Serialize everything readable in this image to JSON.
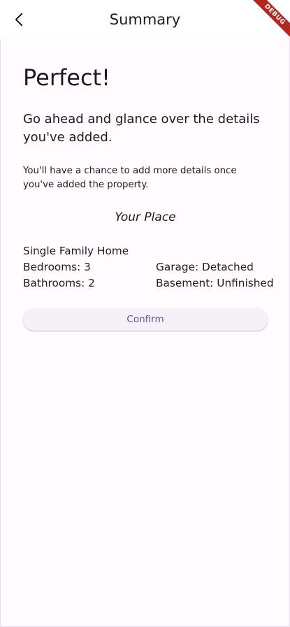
{
  "appbar": {
    "title": "Summary",
    "back_icon": "arrow-back-icon",
    "debug_banner": "DEBUG"
  },
  "main": {
    "heading": "Perfect!",
    "subheading": "Go ahead and glance over the details you've added.",
    "note": "You'll have a chance to add more details once you've added the property.",
    "place_title": "Your Place",
    "property_type": "Single Family Home",
    "bedrooms": "Bedrooms: 3",
    "bathrooms": "Bathrooms: 2",
    "garage": "Garage: Detached",
    "basement": "Basement: Unfinished",
    "confirm_label": "Confirm"
  },
  "colors": {
    "background": "#fffbfe",
    "appbar": "#ffffff",
    "primary": "#6750a4",
    "debug_ribbon": "#b3261e"
  }
}
